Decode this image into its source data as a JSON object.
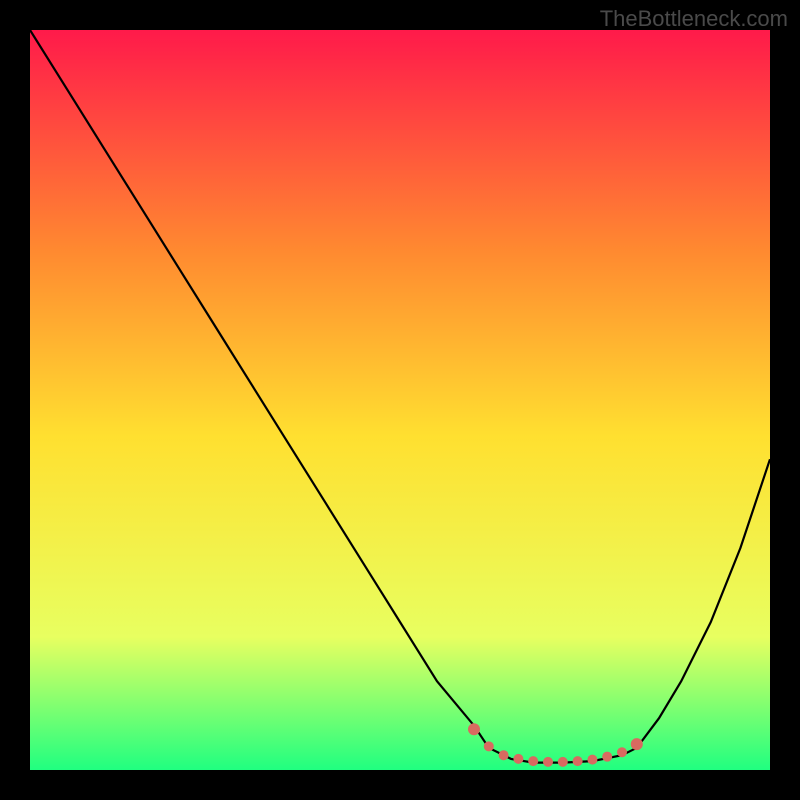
{
  "watermark": "TheBottleneck.com",
  "chart_data": {
    "type": "line",
    "title": "",
    "xlabel": "",
    "ylabel": "",
    "xlim": [
      0,
      100
    ],
    "ylim": [
      0,
      100
    ],
    "background_gradient": {
      "top": "#ff1a4a",
      "upper_mid": "#ff8a30",
      "mid": "#ffe030",
      "lower": "#e8ff60",
      "bottom": "#20ff80"
    },
    "series": [
      {
        "name": "bottleneck-curve",
        "color": "#000000",
        "x": [
          0,
          5,
          10,
          15,
          20,
          25,
          30,
          35,
          40,
          45,
          50,
          55,
          60,
          62,
          65,
          68,
          72,
          76,
          80,
          82,
          85,
          88,
          92,
          96,
          100
        ],
        "y": [
          100,
          92,
          84,
          76,
          68,
          60,
          52,
          44,
          36,
          28,
          20,
          12,
          6,
          3,
          1.5,
          1,
          1,
          1.2,
          2,
          3,
          7,
          12,
          20,
          30,
          42
        ]
      }
    ],
    "markers": {
      "name": "highlighted-range",
      "color": "#d86a60",
      "points_x": [
        60,
        62,
        64,
        66,
        68,
        70,
        72,
        74,
        76,
        78,
        80,
        82
      ],
      "points_y": [
        5.5,
        3.2,
        2.0,
        1.5,
        1.2,
        1.1,
        1.1,
        1.2,
        1.4,
        1.8,
        2.4,
        3.5
      ]
    }
  }
}
